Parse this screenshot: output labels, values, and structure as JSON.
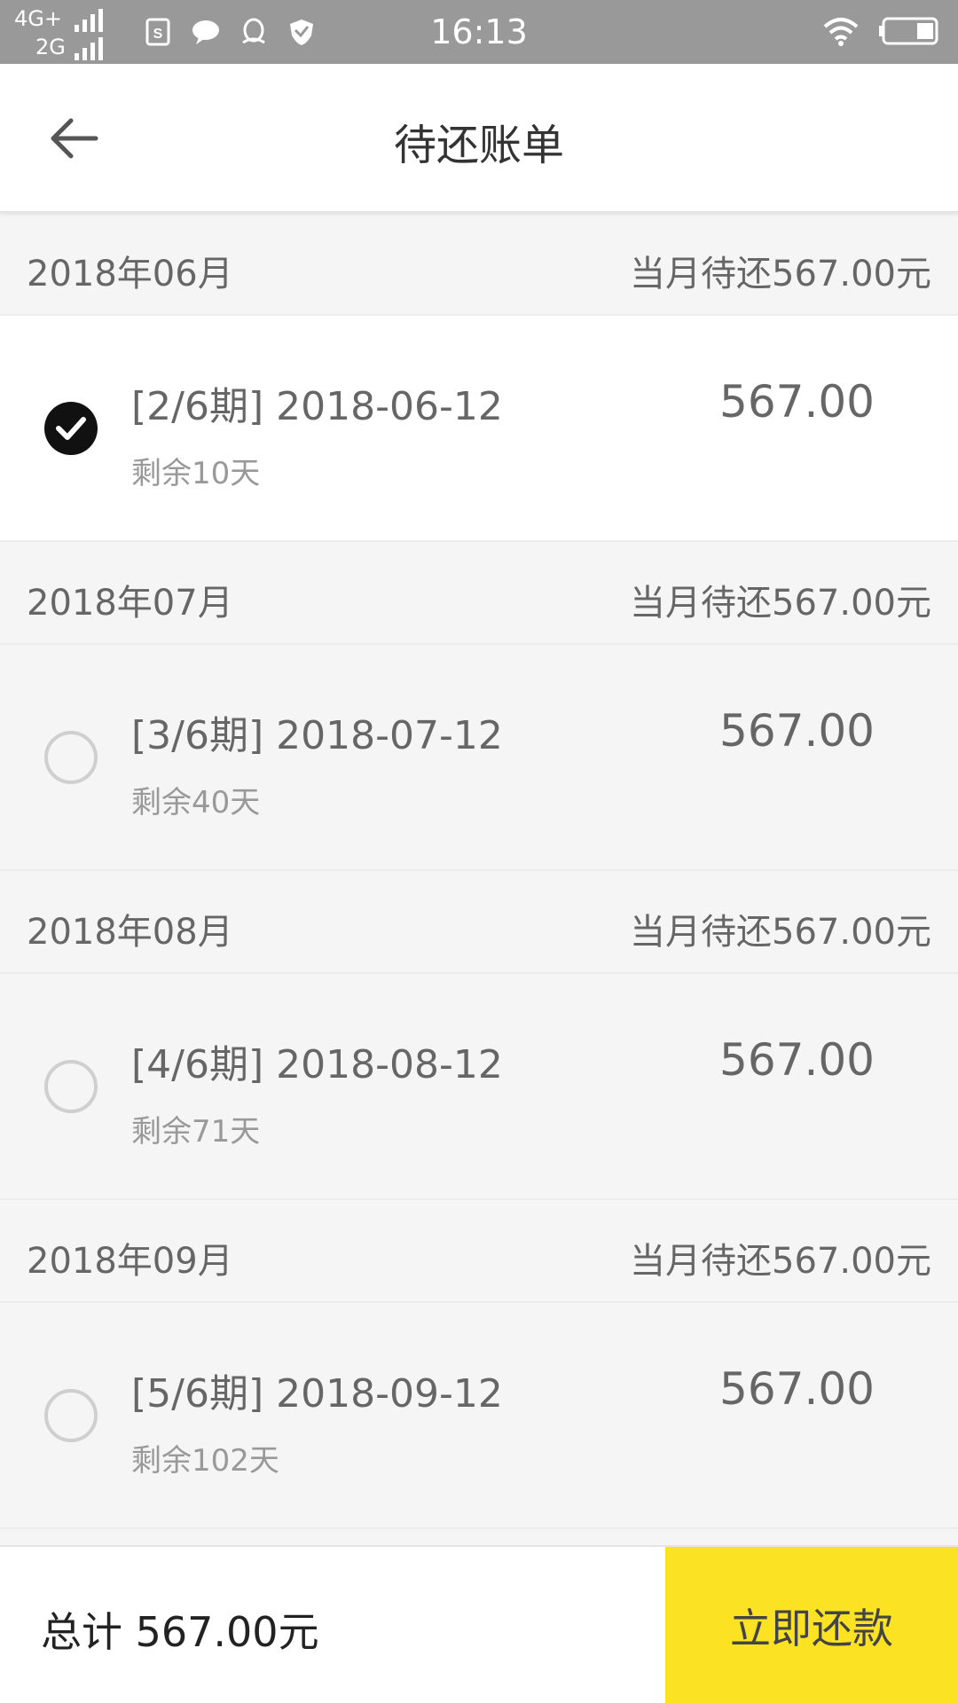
{
  "status_bar": {
    "network_top": "4G+",
    "network_bottom": "2G",
    "time": "16:13",
    "notification_icons": [
      "s-app-icon",
      "chat-icon",
      "qq-icon",
      "shield-icon"
    ]
  },
  "header": {
    "title": "待还账单"
  },
  "months": [
    {
      "label": "2018年06月",
      "due": "当月待还567.00元",
      "bill": {
        "period": "[2/6期] 2018-06-12",
        "remain": "剩余10天",
        "amount": "567.00",
        "selected": true
      }
    },
    {
      "label": "2018年07月",
      "due": "当月待还567.00元",
      "bill": {
        "period": "[3/6期] 2018-07-12",
        "remain": "剩余40天",
        "amount": "567.00",
        "selected": false
      }
    },
    {
      "label": "2018年08月",
      "due": "当月待还567.00元",
      "bill": {
        "period": "[4/6期] 2018-08-12",
        "remain": "剩余71天",
        "amount": "567.00",
        "selected": false
      }
    },
    {
      "label": "2018年09月",
      "due": "当月待还567.00元",
      "bill": {
        "period": "[5/6期] 2018-09-12",
        "remain": "剩余102天",
        "amount": "567.00",
        "selected": false
      }
    }
  ],
  "footer": {
    "total": "总计 567.00元",
    "pay_button": "立即还款"
  },
  "colors": {
    "accent": "#fbe222",
    "status_bar": "#999999",
    "background": "#f5f5f5"
  }
}
